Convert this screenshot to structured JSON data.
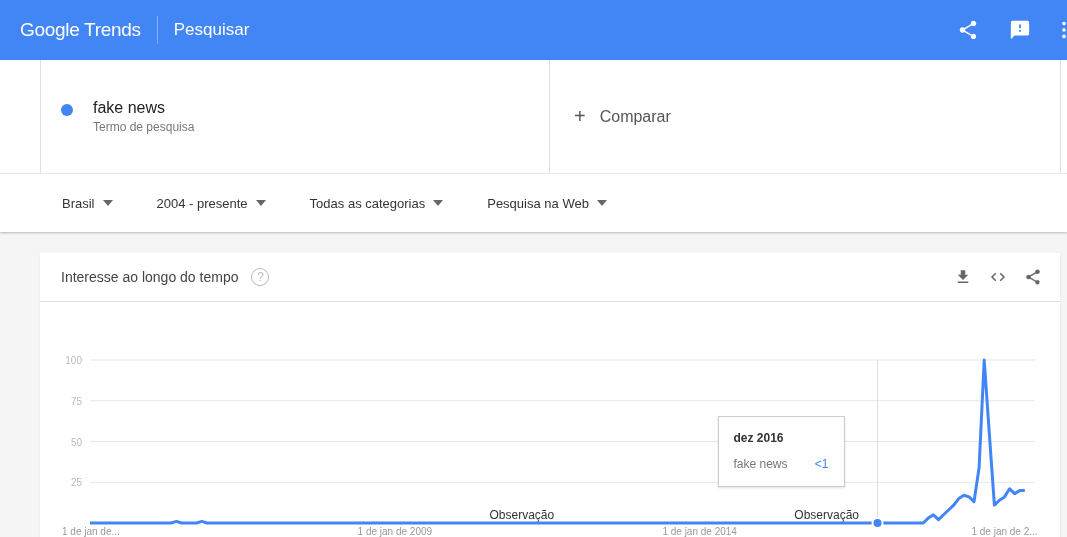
{
  "header": {
    "logo": "Google Trends",
    "title": "Pesquisar"
  },
  "search_terms": [
    {
      "term": "fake news",
      "subtitle": "Termo de pesquisa",
      "color": "#4285f4"
    }
  ],
  "compare": {
    "icon_text": "+",
    "label": "Comparar"
  },
  "filters": [
    {
      "label": "Brasil"
    },
    {
      "label": "2004 - presente"
    },
    {
      "label": "Todas as categorias"
    },
    {
      "label": "Pesquisa na Web"
    }
  ],
  "interest_card": {
    "title": "Interesse ao longo do tempo",
    "help": "?",
    "chart_data": {
      "type": "line",
      "grid": true,
      "ylim": [
        0,
        100
      ],
      "yticks": [
        25,
        50,
        75,
        100
      ],
      "categories": [
        "1 de jan de...",
        null,
        null,
        null,
        null,
        null,
        null,
        null,
        null,
        null,
        null,
        null,
        null,
        null,
        null,
        null,
        null,
        null,
        null,
        null,
        null,
        null,
        null,
        null,
        null,
        null,
        null,
        null,
        null,
        null,
        null,
        null,
        null,
        null,
        null,
        null,
        null,
        null,
        null,
        null,
        null,
        null,
        null,
        null,
        null,
        null,
        null,
        null,
        null,
        null,
        null,
        null,
        null,
        null,
        null,
        null,
        null,
        null,
        null,
        null,
        "1 de jan de 2009",
        null,
        null,
        null,
        null,
        null,
        null,
        null,
        null,
        null,
        null,
        null,
        null,
        null,
        null,
        null,
        null,
        null,
        null,
        null,
        null,
        null,
        null,
        null,
        null,
        null,
        null,
        null,
        null,
        null,
        null,
        null,
        null,
        null,
        null,
        null,
        null,
        null,
        null,
        null,
        null,
        null,
        null,
        null,
        null,
        null,
        null,
        null,
        null,
        null,
        null,
        null,
        null,
        null,
        null,
        null,
        null,
        null,
        null,
        null,
        "1 de jan de 2014",
        null,
        null,
        null,
        null,
        null,
        null,
        null,
        null,
        null,
        null,
        null,
        null,
        null,
        null,
        null,
        null,
        null,
        null,
        null,
        null,
        null,
        null,
        null,
        null,
        null,
        null,
        null,
        null,
        null,
        null,
        null,
        null,
        null,
        null,
        null,
        null,
        null,
        null,
        null,
        null,
        null,
        null,
        null,
        null,
        null,
        null,
        null,
        null,
        null,
        null,
        null,
        null,
        null,
        null,
        null,
        null,
        null,
        null,
        null,
        "1 de jan de 2...",
        null,
        null,
        null,
        null
      ],
      "series": [
        {
          "name": "fake news",
          "color": "#4285f4",
          "values": [
            0,
            0,
            0,
            0,
            0,
            0,
            0,
            0,
            0,
            0,
            0,
            0,
            0,
            0,
            0,
            0,
            0,
            1,
            0,
            0,
            0,
            0,
            1,
            0,
            0,
            0,
            0,
            0,
            0,
            0,
            0,
            0,
            0,
            0,
            0,
            0,
            0,
            0,
            0,
            0,
            0,
            0,
            0,
            0,
            0,
            0,
            0,
            0,
            0,
            0,
            0,
            0,
            0,
            0,
            0,
            0,
            0,
            0,
            0,
            0,
            0,
            0,
            0,
            0,
            0,
            0,
            0,
            0,
            0,
            0,
            0,
            0,
            0,
            0,
            0,
            0,
            0,
            0,
            0,
            0,
            0,
            0,
            0,
            0,
            0,
            0,
            0,
            0,
            0,
            0,
            0,
            0,
            0,
            0,
            0,
            0,
            0,
            0,
            0,
            0,
            0,
            0,
            0,
            0,
            0,
            0,
            0,
            0,
            0,
            0,
            0,
            0,
            0,
            0,
            0,
            0,
            0,
            0,
            0,
            0,
            0,
            0,
            0,
            0,
            0,
            0,
            0,
            0,
            0,
            0,
            0,
            0,
            0,
            0,
            0,
            0,
            0,
            0,
            0,
            0,
            0,
            0,
            0,
            0,
            0,
            0,
            0,
            0,
            0,
            0,
            0,
            0,
            0,
            0,
            0,
            0,
            0,
            0,
            0,
            0,
            0,
            0,
            0,
            0,
            0,
            3,
            5,
            2,
            5,
            8,
            11,
            15,
            17,
            16,
            13,
            34,
            100,
            55,
            11,
            14,
            16,
            21,
            18,
            20,
            20
          ]
        }
      ],
      "annotations": [
        "Observação",
        "Observação"
      ]
    },
    "tooltip": {
      "title": "dez 2016",
      "value": "<1"
    }
  }
}
